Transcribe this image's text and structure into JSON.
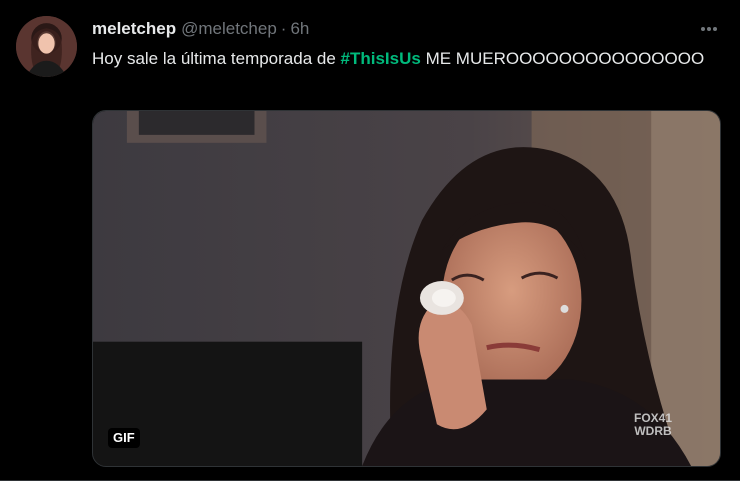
{
  "tweet": {
    "display_name": "meletchep",
    "handle": "@meletchep",
    "separator": "·",
    "time": "6h",
    "text_before": "Hoy sale la última temporada de ",
    "hashtag": "#ThisIsUs",
    "text_after": " ME MUEROOOOOOOOOOOOOOO",
    "more_icon": "more-horizontal-icon"
  },
  "media": {
    "badge": "GIF",
    "watermark_line1": "FOX41",
    "watermark_line2": "WDRB"
  },
  "colors": {
    "background": "#000000",
    "text": "#e7e9ea",
    "secondary": "#71767b",
    "hashtag": "#00ba7c"
  }
}
